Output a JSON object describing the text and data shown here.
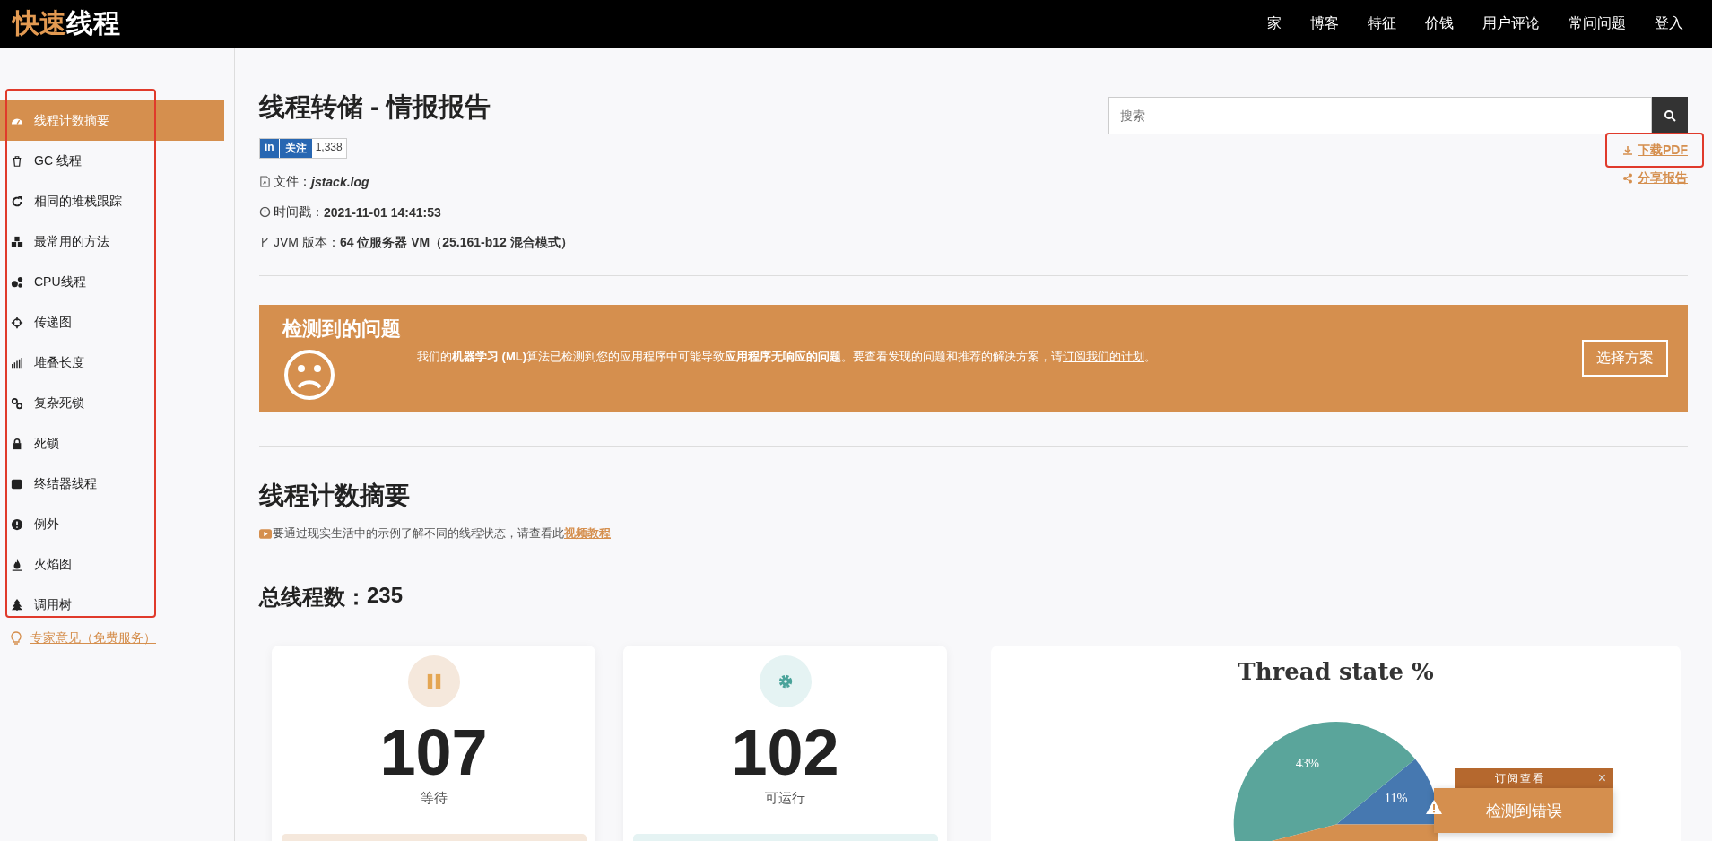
{
  "nav": {
    "logo_accent": "快速",
    "logo_rest": "线程",
    "links": [
      "家",
      "博客",
      "特征",
      "价钱",
      "用户评论",
      "常问问题",
      "登入"
    ]
  },
  "sidebar": {
    "items": [
      {
        "label": "线程计数摘要",
        "selected": true
      },
      {
        "label": "GC 线程",
        "selected": false
      },
      {
        "label": "相同的堆栈跟踪",
        "selected": false
      },
      {
        "label": "最常用的方法",
        "selected": false
      },
      {
        "label": "CPU线程",
        "selected": false
      },
      {
        "label": "传递图",
        "selected": false
      },
      {
        "label": "堆叠长度",
        "selected": false
      },
      {
        "label": "复杂死锁",
        "selected": false
      },
      {
        "label": "死锁",
        "selected": false
      },
      {
        "label": "终结器线程",
        "selected": false
      },
      {
        "label": "例外",
        "selected": false
      },
      {
        "label": "火焰图",
        "selected": false
      },
      {
        "label": "调用树",
        "selected": false
      }
    ],
    "expert_link": "专家意见（免费服务）"
  },
  "report": {
    "title": "线程转储 - 情报报告",
    "linkedin": {
      "logo": "in",
      "label": "关注",
      "count": "1,338"
    },
    "meta": [
      {
        "label": "文件：",
        "value": "jstack.log",
        "italic": true
      },
      {
        "label": "时间戳：",
        "value": "2021-11-01 14:41:53",
        "italic": false
      },
      {
        "label": "JVM 版本：",
        "value": "64 位服务器 VM（25.161-b12 混合模式）",
        "italic": false
      }
    ],
    "search": {
      "placeholder": "搜索"
    },
    "download": "下载PDF",
    "share": "分享报告"
  },
  "banner": {
    "title": "检测到的问题",
    "message": "我们的**机器学习 (ML)**算法已检测到您的应用程序中可能导致**应用程序无响应的问题**。要查看发现的问题和推荐的解决方案，请",
    "link": "订阅我们的计划",
    "end": "。",
    "button": "选择方案"
  },
  "summary": {
    "title": "线程计数摘要",
    "hint": "要通过现实生活中的示例了解不同的线程状态，请查看此",
    "hint_link": "视频教程",
    "total_label": "总线程数：",
    "total": "235",
    "cards": [
      {
        "kind": "waiting",
        "count": "107",
        "label": "等待"
      },
      {
        "kind": "runnable",
        "count": "102",
        "label": "可运行"
      }
    ],
    "chart_data": {
      "type": "pie",
      "title": "Thread state %",
      "values": [
        43,
        11,
        46
      ],
      "colors": [
        "#5aa59b",
        "#4678b0",
        "#d58f4e"
      ],
      "value_labels": [
        "43%",
        "11%",
        null
      ]
    }
  },
  "popup": {
    "header": "订阅查看",
    "close": "×",
    "message": "检测到错误"
  },
  "highlights": {
    "sidebar": true,
    "download": true
  }
}
